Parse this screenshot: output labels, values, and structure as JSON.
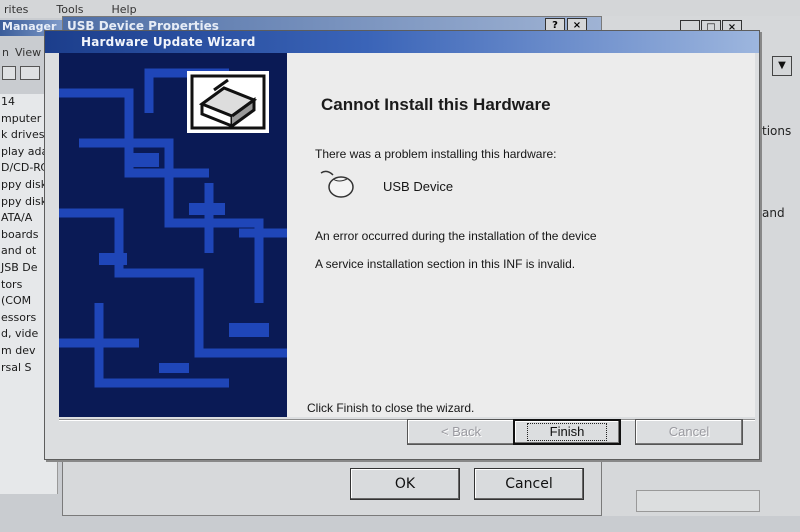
{
  "background_app": {
    "menu": [
      "rites",
      "Tools",
      "Help"
    ],
    "title_fragment": "Manager",
    "toolbar_view": "View",
    "toolbar_n": "n",
    "tree_items": [
      "14",
      "mputer",
      "k drives",
      "play ada",
      "D/CD-RC",
      "ppy disk",
      "ppy disk",
      "ATA/A",
      "boards",
      "and ot",
      "JSB De",
      "tors",
      "(COM",
      "essors",
      "d, vide",
      "m dev",
      "rsal S"
    ],
    "right_fragments": [
      "tions",
      "and"
    ]
  },
  "props_dialog": {
    "title": "USB Device Properties",
    "help_btn": "?",
    "close_btn": "×",
    "ok_label": "OK",
    "cancel_label": "Cancel"
  },
  "right_window": {
    "controls": [
      "_",
      "□",
      "×"
    ],
    "dropdown": "▼"
  },
  "wizard": {
    "title": "Hardware Update Wizard",
    "heading": "Cannot Install this Hardware",
    "problem_text": "There was a problem installing this hardware:",
    "device_name": "USB Device",
    "error_line1": "An error occurred during the installation of the device",
    "error_line2": "A service installation section in this INF is invalid.",
    "finish_hint": "Click Finish to close the wizard.",
    "buttons": {
      "back": "< Back",
      "finish": "Finish",
      "cancel": "Cancel"
    },
    "icons": {
      "banner": "hardware-box-icon",
      "device": "mouse-device-icon"
    },
    "colors": {
      "banner_bg": "#0a1a55",
      "banner_pattern": "#1f46b8",
      "title_start": "#1c3e8c",
      "title_end": "#9db6de"
    }
  }
}
